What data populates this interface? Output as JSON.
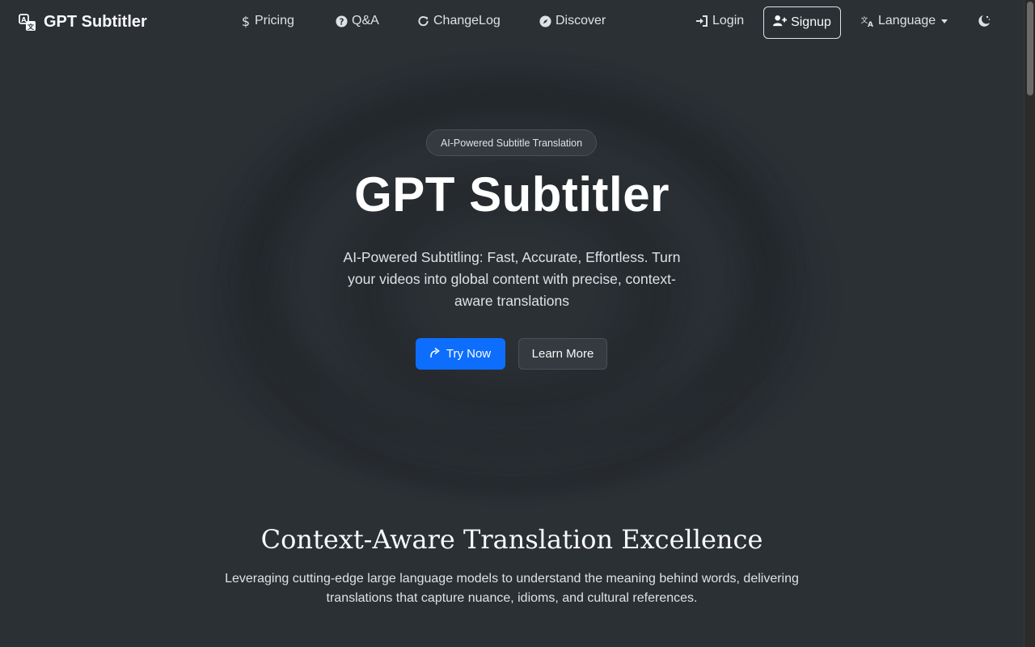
{
  "colors": {
    "background": "#2b3035",
    "primary": "#0d6efd",
    "text": "#dee2e6",
    "heading": "#ffffff"
  },
  "navbar": {
    "brand": "GPT Subtitler",
    "brand_icon": "translate-icon",
    "links": [
      {
        "label": "Pricing",
        "icon": "dollar-icon"
      },
      {
        "label": "Q&A",
        "icon": "question-circle-icon"
      },
      {
        "label": "ChangeLog",
        "icon": "refresh-icon"
      },
      {
        "label": "Discover",
        "icon": "compass-icon"
      }
    ],
    "login_label": "Login",
    "login_icon": "sign-in-icon",
    "signup_label": "Signup",
    "signup_icon": "user-plus-icon",
    "language_label": "Language",
    "language_icon": "language-icon",
    "theme_icon": "moon-stars-icon"
  },
  "hero": {
    "badge": "AI-Powered Subtitle Translation",
    "title": "GPT Subtitler",
    "subtitle": "AI-Powered Subtitling: Fast, Accurate, Effortless. Turn your videos into global content with precise, context-aware translations",
    "try_now_label": "Try Now",
    "try_now_icon": "arrow-up-right-icon",
    "learn_more_label": "Learn More"
  },
  "features": {
    "title": "Context-Aware Translation Excellence",
    "description": "Leveraging cutting-edge large language models to understand the meaning behind words, delivering translations that capture nuance, idioms, and cultural references."
  }
}
